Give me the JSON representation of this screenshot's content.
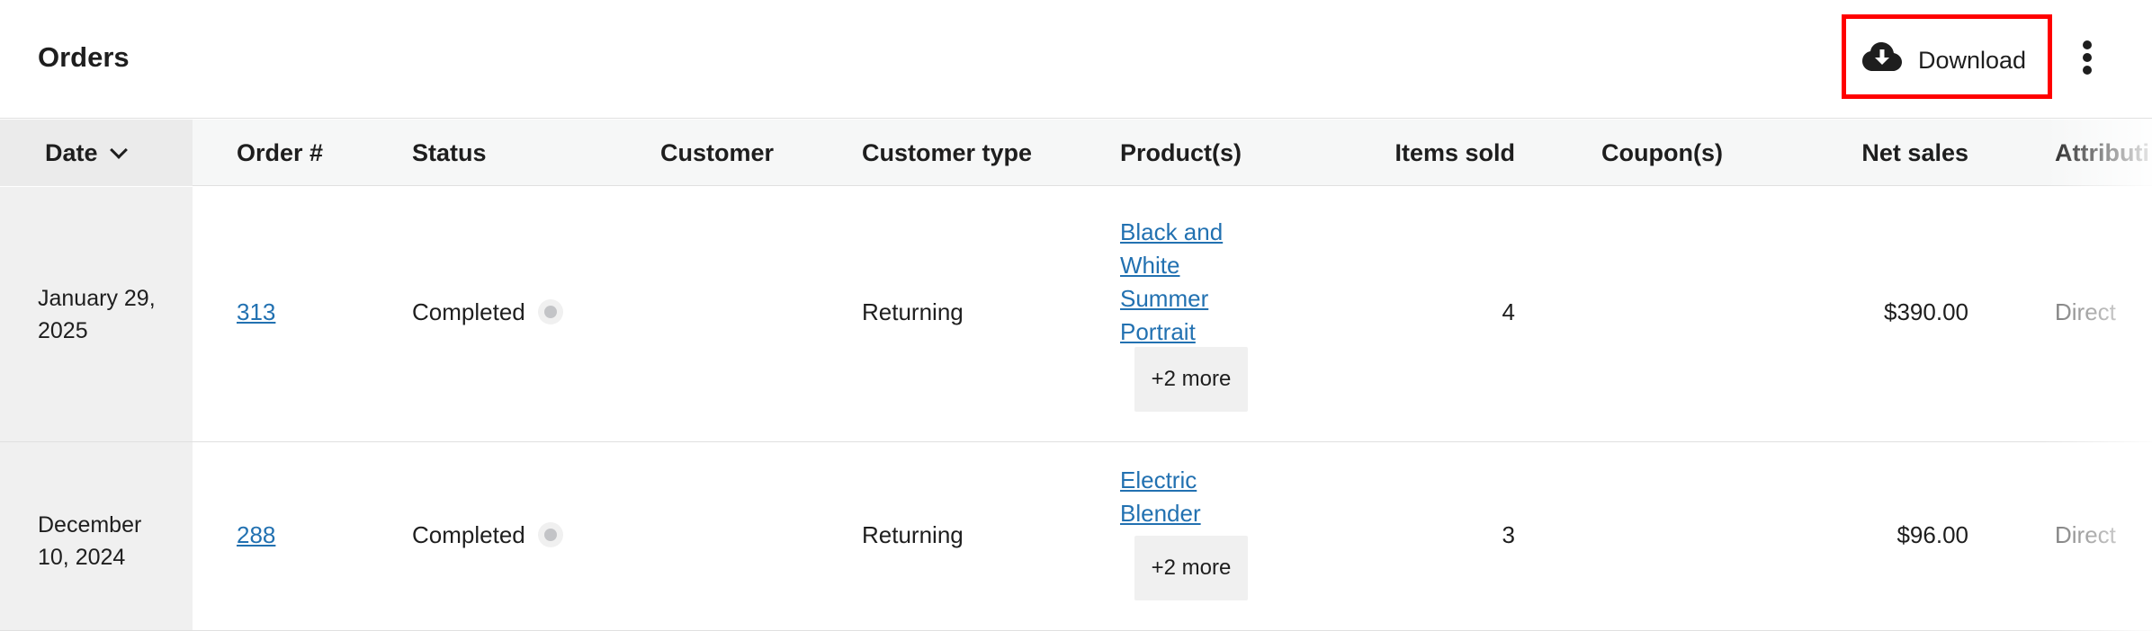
{
  "header": {
    "title": "Orders",
    "download_label": "Download"
  },
  "table": {
    "columns": [
      "Date",
      "Order #",
      "Status",
      "Customer",
      "Customer type",
      "Product(s)",
      "Items sold",
      "Coupon(s)",
      "Net sales",
      "Attributi"
    ],
    "rows": [
      {
        "date": "January 29, 2025",
        "order": "313",
        "status": "Completed",
        "customer": "",
        "customer_type": "Returning",
        "product": "Black and White Summer Portrait",
        "more": "+2 more",
        "items_sold": "4",
        "coupons": "",
        "net_sales": "$390.00",
        "attribution": "Direct"
      },
      {
        "date": "December 10, 2024",
        "order": "288",
        "status": "Completed",
        "customer": "",
        "customer_type": "Returning",
        "product": "Electric Blender",
        "more": "+2 more",
        "items_sold": "3",
        "coupons": "",
        "net_sales": "$96.00",
        "attribution": "Direct"
      }
    ]
  },
  "icons": {
    "download": "cloud-download-icon",
    "more": "more-vertical-icon",
    "sort": "chevron-down-icon"
  }
}
